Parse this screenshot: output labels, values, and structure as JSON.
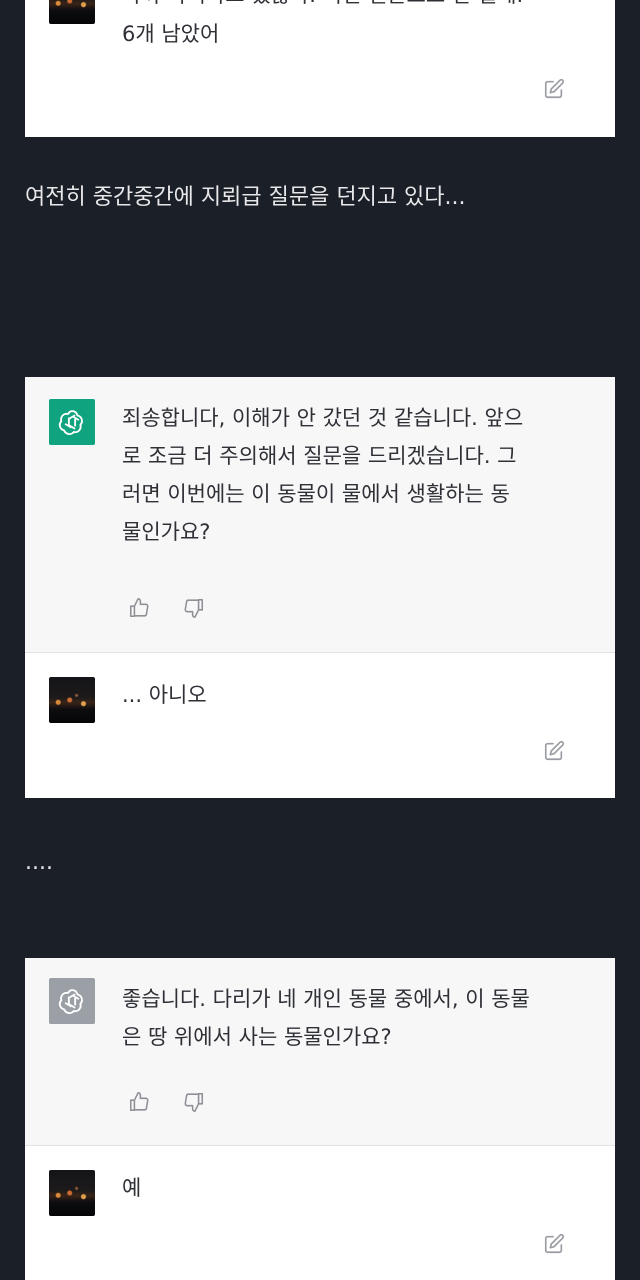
{
  "card1": {
    "top_text_partial": "아까 아니라고 했잖아. 이런 질문으로 안 될게.",
    "user_message_line2": "6개 남았어",
    "edit_icon": "edit-icon"
  },
  "caption1": "여전히 중간중간에 지뢰급 질문을 던지고 있다...",
  "card2": {
    "bot_message": "죄송합니다, 이해가 안 갔던 것 같습니다. 앞으\n로 조금 더 주의해서 질문을 드리겠습니다. 그\n러면 이번에는 이 동물이 물에서 생활하는 동\n물인가요?",
    "user_message": "... 아니오"
  },
  "caption2": "....",
  "card3": {
    "bot_message": "좋습니다. 다리가 네 개인 동물 중에서, 이 동물\n은 땅 위에서 사는 동물인가요?",
    "user_message": "예"
  },
  "colors": {
    "page_bg": "#1b1f27",
    "gpt_green": "#10a37f",
    "gpt_gray": "#9aa0a6"
  }
}
